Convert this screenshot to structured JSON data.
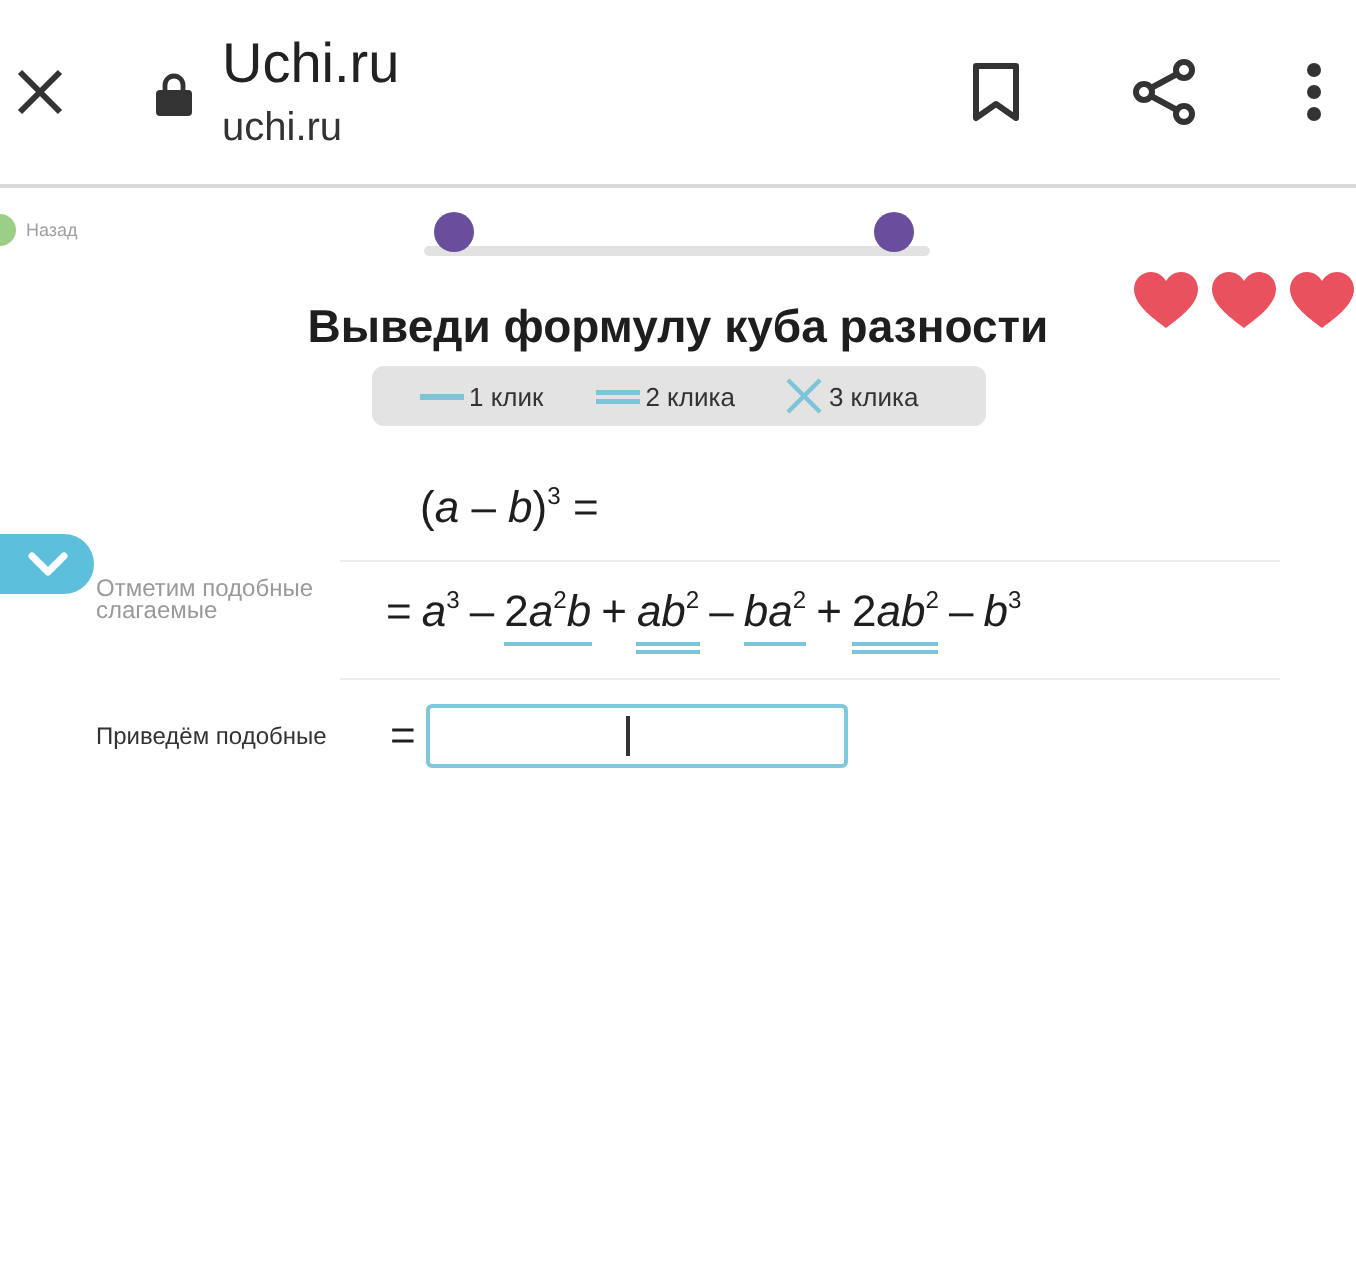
{
  "browser": {
    "title": "Uchi.ru",
    "url": "uchi.ru"
  },
  "back_link": {
    "label": "Назад"
  },
  "progress": {
    "steps": [
      {
        "done": true
      },
      {
        "done": true
      }
    ]
  },
  "lives": [
    {
      "full": true
    },
    {
      "full": true
    },
    {
      "full": true
    }
  ],
  "title": "Выведи формулу куба разности",
  "legend": [
    {
      "kind": "single",
      "label": "1 клик"
    },
    {
      "kind": "double",
      "label": "2 клика"
    },
    {
      "kind": "cross",
      "label": "3 клика"
    }
  ],
  "steps": [
    {
      "kind": "expression",
      "expression": "(*a* – *b*)$^{3}$ ="
    },
    {
      "kind": "terms",
      "label": "Отметим подобные слагаемые",
      "tokens": [
        {
          "kind": "sign",
          "text": "="
        },
        {
          "kind": "plain",
          "text": "*a*$^{3}$"
        },
        {
          "kind": "sign",
          "text": "–"
        },
        {
          "kind": "single",
          "coefficient": "2",
          "text": "*a*$^{2}$*b*"
        },
        {
          "kind": "sign",
          "text": "+"
        },
        {
          "kind": "double",
          "text": "*ab*$^{2}$"
        },
        {
          "kind": "sign",
          "text": "–"
        },
        {
          "kind": "single",
          "text": "*ba*$^{2}$"
        },
        {
          "kind": "sign",
          "text": "+"
        },
        {
          "kind": "double",
          "coefficient": "2",
          "text": "*ab*$^{2}$"
        },
        {
          "kind": "sign",
          "text": "–"
        },
        {
          "kind": "plain",
          "text": "*b*$^{3}$"
        }
      ]
    },
    {
      "kind": "answer",
      "label": "Приведём подобные",
      "sign": "=",
      "focused": true
    }
  ]
}
